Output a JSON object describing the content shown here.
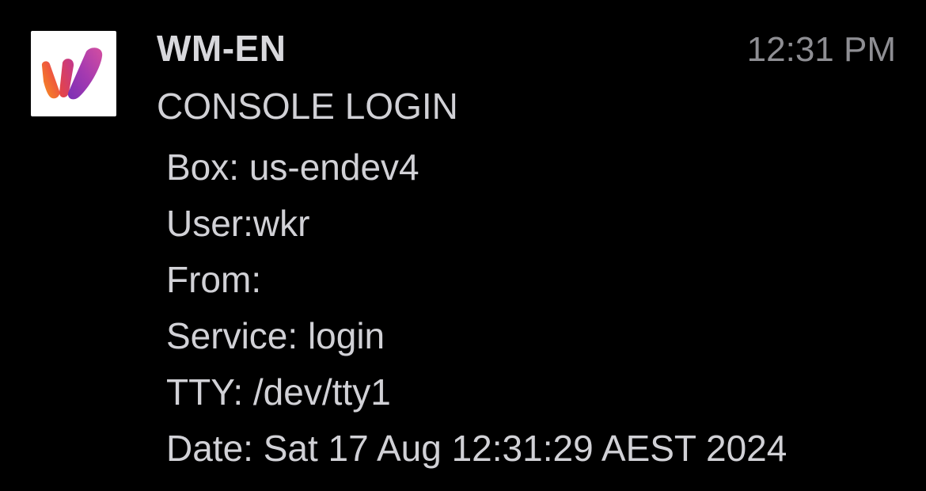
{
  "notification": {
    "app_name": "WM-EN",
    "time": "12:31 PM",
    "title": "CONSOLE LOGIN",
    "icon": "wm-logo-icon",
    "lines": [
      "Box: us-endev4",
      "User:wkr",
      "From:",
      "Service: login",
      "TTY: /dev/tty1",
      "Date: Sat 17 Aug 12:31:29 AEST 2024"
    ]
  },
  "colors": {
    "background": "#000000",
    "text": "#d1d1d6",
    "secondary_text": "#8e8e93",
    "logo_orange": "#f26b2a",
    "logo_magenta": "#d63b7a",
    "logo_purple": "#6a2fb0"
  }
}
